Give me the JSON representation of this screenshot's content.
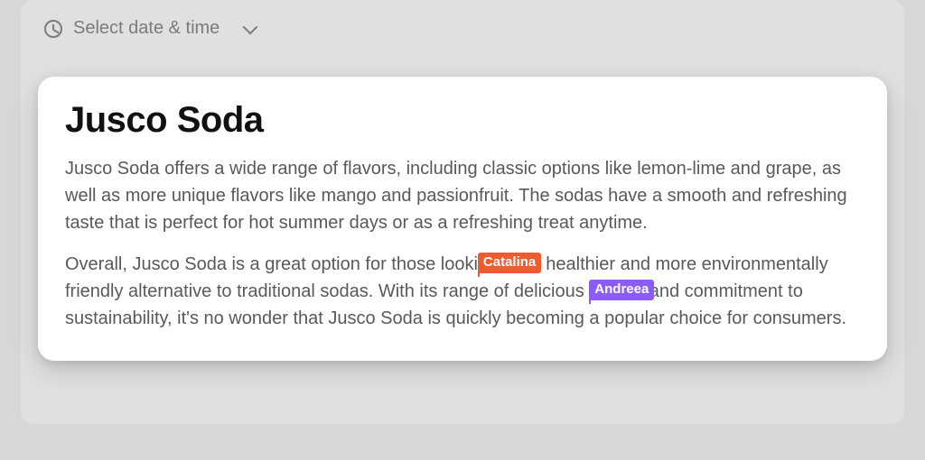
{
  "header": {
    "datetime_label": "Select date & time"
  },
  "document": {
    "title": "Jusco Soda",
    "paragraphs": [
      "Jusco Soda offers a wide range of flavors, including classic options like lemon-lime and grape, as well as more unique flavors like mango and passionfruit. The sodas have a smooth and refreshing taste that is perfect for hot summer days or as a refreshing treat anytime."
    ],
    "p2": {
      "a": "Overall, Jusco Soda is a great option for those looki",
      "b": "ng for a healthier and more environmentally friendly alternative to traditional sodas. With its range of delicious ",
      "c": "flavors and commitment to sustainability, it's no wonder that Jusco Soda is quickly becoming a popular choice for consumers."
    }
  },
  "collaborators": {
    "cursor1": {
      "name": "Catalina",
      "color": "#ee5b2f"
    },
    "cursor2": {
      "name": "Andreea",
      "color": "#8b5cf6"
    }
  }
}
